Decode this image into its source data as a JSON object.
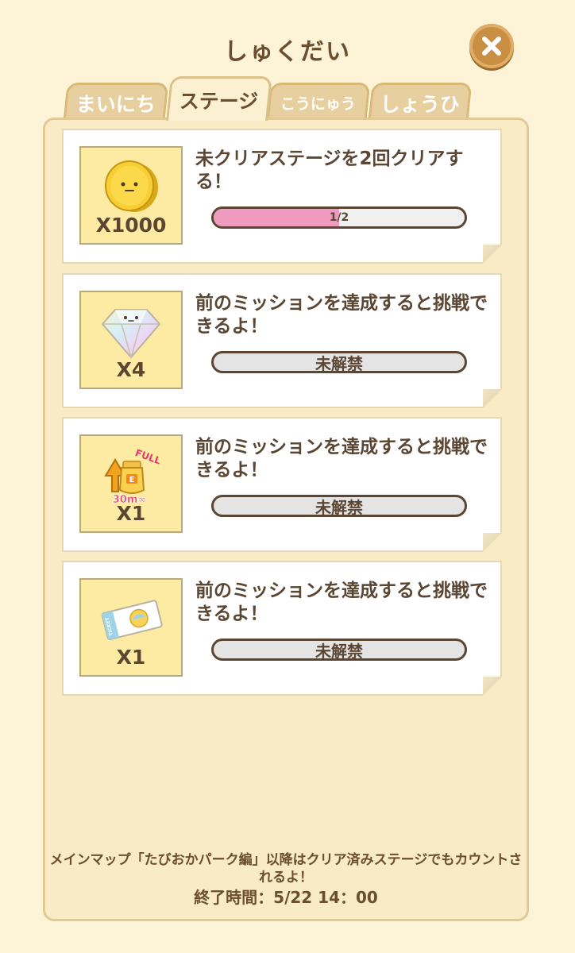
{
  "title": "しゅくだい",
  "close_icon": "close-x-icon",
  "tabs": [
    {
      "label": "まいにち",
      "active": false
    },
    {
      "label": "ステージ",
      "active": true
    },
    {
      "label": "こうにゅう",
      "active": false
    },
    {
      "label": "しょうひ",
      "active": false
    }
  ],
  "missions": [
    {
      "reward_icon": "coin-icon",
      "reward_qty": "X1000",
      "description": "未クリアステージを2回クリアする！",
      "status": "progress",
      "progress_text": "1/2",
      "progress": 0.5
    },
    {
      "reward_icon": "diamond-icon",
      "reward_qty": "X4",
      "description": "前のミッションを達成すると挑戦できるよ！",
      "status": "locked",
      "progress_text": "未解禁"
    },
    {
      "reward_icon": "energy-drink-icon",
      "reward_icon_text": [
        "FULL",
        "E",
        "30m∞"
      ],
      "reward_qty": "X1",
      "description": "前のミッションを達成すると挑戦できるよ！",
      "status": "locked",
      "progress_text": "未解禁"
    },
    {
      "reward_icon": "ticket-icon",
      "reward_icon_text": [
        "TICKET"
      ],
      "reward_qty": "X1",
      "description": "前のミッションを達成すると挑戦できるよ！",
      "status": "locked",
      "progress_text": "未解禁"
    }
  ],
  "footer": {
    "note": "メインマップ「たびおかパーク編」以降はクリア済みステージでもカウントされるよ！",
    "deadline": "終了時間：5/22 14：00"
  },
  "colors": {
    "background": "#fdf4d8",
    "panel": "#f8ebc6",
    "progress_fill": "#ee9bbf",
    "close_button": "#c98f43",
    "reward_bg": "#fdeba3",
    "text": "#5a4632"
  }
}
